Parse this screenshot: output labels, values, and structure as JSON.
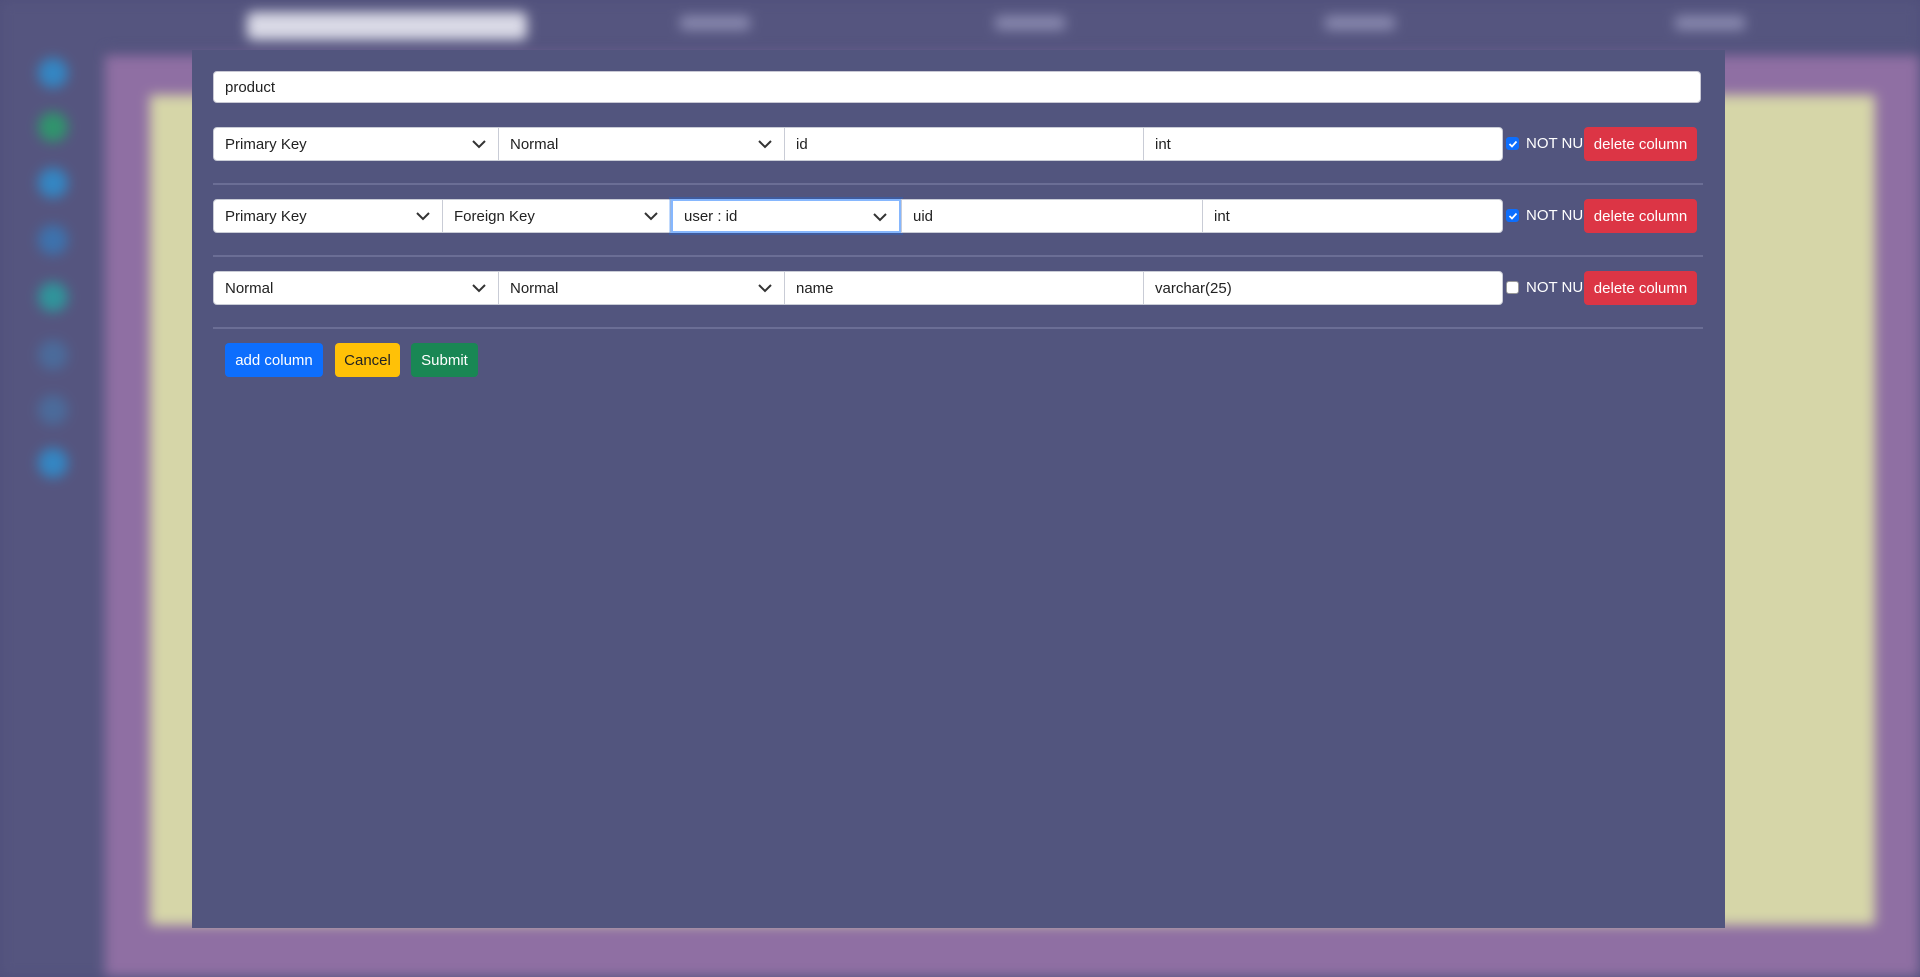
{
  "table_name": "product",
  "columns": [
    {
      "key_type": "Primary Key",
      "fk_type": "Normal",
      "reference": "",
      "name": "id",
      "data_type": "int",
      "not_null": true,
      "not_null_label": "NOT NULL",
      "delete_label": "delete column"
    },
    {
      "key_type": "Primary Key",
      "fk_type": "Foreign Key",
      "reference": "user : id",
      "name": "uid",
      "data_type": "int",
      "not_null": true,
      "not_null_label": "NOT NULL",
      "delete_label": "delete column"
    },
    {
      "key_type": "Normal",
      "fk_type": "Normal",
      "reference": "",
      "name": "name",
      "data_type": "varchar(25)",
      "not_null": false,
      "not_null_label": "NOT NULL",
      "delete_label": "delete column"
    }
  ],
  "buttons": {
    "add_column": "add column",
    "cancel": "Cancel",
    "submit": "Submit"
  },
  "colors": {
    "modal_bg": "#52557e",
    "delete": "#dc3545",
    "primary": "#0d6efd",
    "warning": "#ffc107",
    "success": "#198754"
  }
}
